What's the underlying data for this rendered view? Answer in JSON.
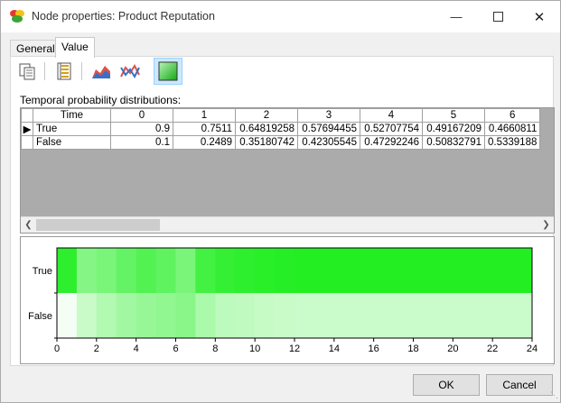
{
  "window": {
    "title": "Node properties: Product Reputation",
    "minimize_icon": "minimize-icon",
    "maximize_icon": "maximize-icon",
    "close_icon": "close-icon"
  },
  "tabs": [
    {
      "label": "General",
      "active": false
    },
    {
      "label": "Value",
      "active": true
    }
  ],
  "toolbar": [
    {
      "icon": "copy-icon",
      "active": false
    },
    {
      "icon": "table-view-icon",
      "active": false
    },
    {
      "icon": "area-chart-icon",
      "active": false
    },
    {
      "icon": "line-chart-icon",
      "active": false
    },
    {
      "icon": "heatmap-view-icon",
      "active": true
    }
  ],
  "caption": "Temporal probability distributions:",
  "table": {
    "columns": [
      "Time",
      "0",
      "1",
      "2",
      "3",
      "4",
      "5",
      "6"
    ],
    "rows": [
      {
        "label": "True",
        "values": [
          "0.9",
          "0.7511",
          "0.64819258",
          "0.57694455",
          "0.52707754",
          "0.49167209",
          "0.4660811"
        ]
      },
      {
        "label": "False",
        "values": [
          "0.1",
          "0.2489",
          "0.35180742",
          "0.42305545",
          "0.47292246",
          "0.50832791",
          "0.5339188"
        ]
      }
    ]
  },
  "chart_data": {
    "type": "heatmap",
    "states": [
      "True",
      "False"
    ],
    "x_ticks": [
      "0",
      "2",
      "4",
      "6",
      "8",
      "10",
      "12",
      "14",
      "16",
      "18",
      "20",
      "22",
      "24"
    ],
    "xlim": [
      0,
      24
    ],
    "green_shade_true": [
      0.95,
      0.55,
      0.6,
      0.7,
      0.78,
      0.72,
      0.6,
      0.85,
      0.92,
      0.95,
      0.97,
      0.98,
      1,
      1,
      1,
      1,
      1,
      1,
      1,
      1,
      1,
      1,
      1,
      1
    ],
    "green_shade_false": [
      0.05,
      0.25,
      0.35,
      0.42,
      0.47,
      0.5,
      0.53,
      0.38,
      0.3,
      0.28,
      0.26,
      0.25,
      0.24,
      0.24,
      0.24,
      0.24,
      0.24,
      0.24,
      0.24,
      0.24,
      0.24,
      0.24,
      0.24,
      0.24
    ],
    "color": "#22ee22"
  },
  "buttons": {
    "ok": "OK",
    "cancel": "Cancel"
  }
}
